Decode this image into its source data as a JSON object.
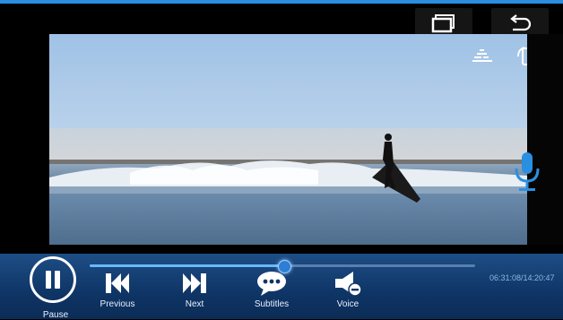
{
  "top_bar": {
    "recent_apps_icon": "recent-apps-icon",
    "back_icon": "back-arrow-icon"
  },
  "video": {
    "overlay_icons": [
      "equalizer-icon",
      "rotate-screen-icon"
    ],
    "mic_icon": "microphone-icon"
  },
  "playback": {
    "time": "06:31:08/14:20:47",
    "progress": 0.505
  },
  "controls": {
    "pause_label": "Pause",
    "previous_label": "Previous",
    "next_label": "Next",
    "subtitles_label": "Subtitles",
    "voice_label": "Voice"
  },
  "colors": {
    "accent": "#2a8fe0",
    "bar_bg": "#0f3566",
    "mic": "#2a8fe0"
  }
}
